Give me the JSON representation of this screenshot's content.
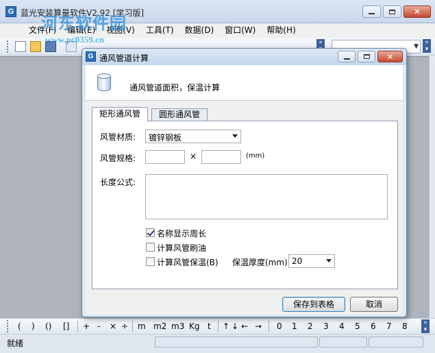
{
  "main_window": {
    "title": "蓝光安装算量软件V2.92 [学习版]",
    "icon_letter": "G",
    "watermark_text": "河东软件园",
    "watermark_url": "www.pc0359.cn"
  },
  "menu": [
    "文件(F)",
    "编辑(E)",
    "视图(V)",
    "工具(T)",
    "数据(D)",
    "窗口(W)",
    "帮助(H)"
  ],
  "toolbar": {
    "combo_value": ""
  },
  "symbol_bar": {
    "groups": [
      [
        "(",
        ")",
        "()",
        "[]"
      ],
      [
        "+",
        "-",
        "×",
        "÷"
      ],
      [
        "m",
        "m2",
        "m3",
        "Kg",
        "t"
      ],
      [
        "↑",
        "↓",
        "←",
        "→"
      ],
      [
        "0",
        "1",
        "2",
        "3",
        "4",
        "5",
        "6",
        "7",
        "8"
      ]
    ]
  },
  "status": {
    "text": "就绪"
  },
  "dialog": {
    "title": "通风管道计算",
    "icon_letter": "G",
    "description": "通风管道面积，保温计算",
    "tabs": [
      "矩形通风管",
      "圆形通风管"
    ],
    "active_tab": 0,
    "material_label": "风管材质:",
    "material_value": "镀锌钢板",
    "spec_label": "风管规格:",
    "spec_width": "",
    "spec_height": "",
    "times_sign": "×",
    "unit": "(mm)",
    "length_label": "长度公式:",
    "length_formula": "",
    "checkboxes": [
      {
        "label": "名称显示周长",
        "checked": true
      },
      {
        "label": "计算风管刷油",
        "checked": false
      },
      {
        "label": "计算风管保温(B)",
        "checked": false
      }
    ],
    "insulation_label": "保温厚度(mm):",
    "insulation_value": "20",
    "save_button": "保存到表格",
    "cancel_button": "取消"
  }
}
